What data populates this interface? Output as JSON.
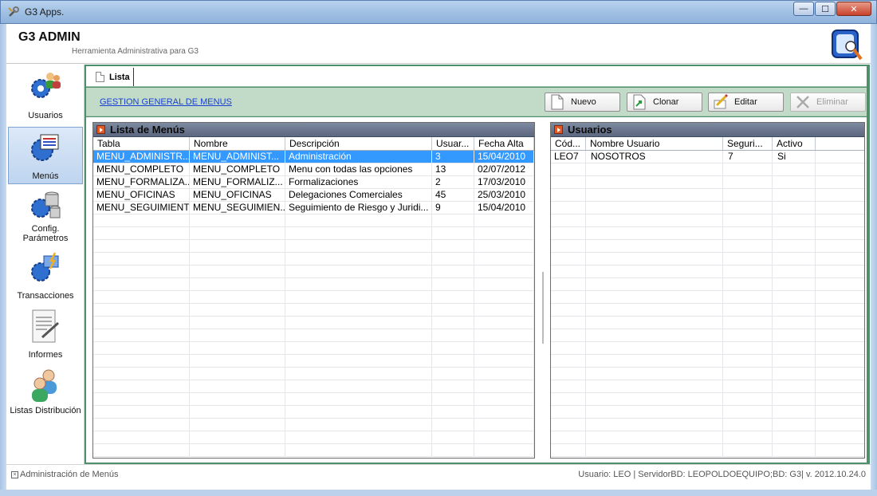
{
  "window": {
    "title": "G3 Apps.",
    "minimize": "—",
    "maximize": "☐",
    "close": "✕"
  },
  "header": {
    "title": "G3 ADMIN",
    "subtitle": "Herramienta Administrativa para G3"
  },
  "sidebar": {
    "items": [
      {
        "label": "Usuarios",
        "icon": "users-gear-icon"
      },
      {
        "label": "Menús",
        "icon": "menu-gear-icon",
        "selected": true
      },
      {
        "label": "Config. Parámetros",
        "icon": "database-gear-icon"
      },
      {
        "label": "Transacciones",
        "icon": "transactions-gear-icon"
      },
      {
        "label": "Informes",
        "icon": "report-document-icon"
      },
      {
        "label": "Listas Distribución",
        "icon": "distribution-users-icon"
      }
    ]
  },
  "tabs": [
    {
      "label": "Lista"
    }
  ],
  "toolbar": {
    "link": "GESTION GENERAL DE MENUS",
    "nuevo": "Nuevo",
    "clonar": "Clonar",
    "editar": "Editar",
    "eliminar": "Eliminar"
  },
  "menus_panel": {
    "title": "Lista de Menús",
    "columns": [
      "Tabla",
      "Nombre",
      "Descripción",
      "Usuar...",
      "Fecha Alta"
    ],
    "rows": [
      [
        "MENU_ADMINISTR...",
        "MENU_ADMINIST...",
        "Administración",
        "3",
        "15/04/2010"
      ],
      [
        "MENU_COMPLETO",
        "MENU_COMPLETO",
        "Menu con todas las opciones",
        "13",
        "02/07/2012"
      ],
      [
        "MENU_FORMALIZA...",
        "MENU_FORMALIZ...",
        "Formalizaciones",
        "2",
        "17/03/2010"
      ],
      [
        "MENU_OFICINAS",
        "MENU_OFICINAS",
        "Delegaciones Comerciales",
        "45",
        "25/03/2010"
      ],
      [
        "MENU_SEGUIMIENTO",
        "MENU_SEGUIMIEN...",
        "Seguimiento de Riesgo y Juridi...",
        "9",
        "15/04/2010"
      ]
    ],
    "selected_row": 0
  },
  "users_panel": {
    "title": "Usuarios",
    "columns": [
      "Cód...",
      "Nombre Usuario",
      "Seguri...",
      "Activo"
    ],
    "rows": [
      [
        "LEO7",
        "NOSOTROS",
        "7",
        "Si"
      ]
    ]
  },
  "status": {
    "left": "Administración de Menús",
    "right": "Usuario: LEO  |  ServidorBD: LEOPOLDOEQUIPO;BD: G3|  v. 2012.10.24.0"
  },
  "colors": {
    "accent_green": "#4f8f6b",
    "selection": "#3399ff",
    "link": "#1a3fd0"
  }
}
